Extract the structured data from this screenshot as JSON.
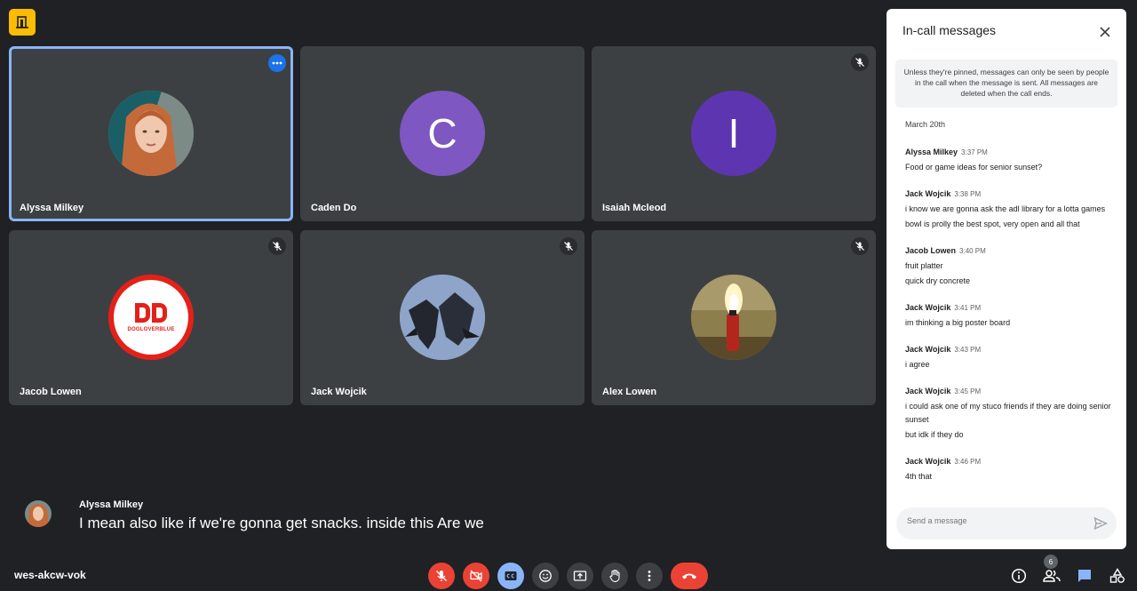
{
  "meeting": {
    "code": "wes-akcw-vok"
  },
  "participants": [
    {
      "name": "Alyssa Milkey",
      "avatar_type": "photo-woman",
      "muted": false,
      "active": true
    },
    {
      "name": "Caden Do",
      "avatar_type": "letter",
      "letter": "C",
      "color": "#7e57c2",
      "muted": false
    },
    {
      "name": "Isaiah Mcleod",
      "avatar_type": "letter",
      "letter": "I",
      "color": "#5e35b1",
      "muted": true
    },
    {
      "name": "Jacob Lowen",
      "avatar_type": "logo",
      "logo_text": "DOGLOVERBLUE",
      "muted": true
    },
    {
      "name": "Jack Wojcik",
      "avatar_type": "jets",
      "muted": true
    },
    {
      "name": "Alex Lowen",
      "avatar_type": "fire",
      "muted": true
    }
  ],
  "caption": {
    "speaker": "Alyssa Milkey",
    "text": "I mean also like if we're gonna get snacks. inside this Are we"
  },
  "people_count": "6",
  "chat": {
    "title": "In-call messages",
    "notice": "Unless they're pinned, messages can only be seen by people in the call when the message is sent. All messages are deleted when the call ends.",
    "date": "March 20th",
    "messages": [
      {
        "sender": "Alyssa Milkey",
        "time": "3:37 PM",
        "lines": [
          "Food or game ideas for senior sunset?"
        ]
      },
      {
        "sender": "Jack Wojcik",
        "time": "3:38 PM",
        "lines": [
          "i know we are gonna ask the adl library for a lotta games",
          "bowl is prolly the best spot, very open and all that"
        ]
      },
      {
        "sender": "Jacob Lowen",
        "time": "3:40 PM",
        "lines": [
          "fruit platter",
          "quick dry concrete"
        ]
      },
      {
        "sender": "Jack Wojcik",
        "time": "3:41 PM",
        "lines": [
          "im thinking a big poster board"
        ]
      },
      {
        "sender": "Jack Wojcik",
        "time": "3:43 PM",
        "lines": [
          "i agree"
        ]
      },
      {
        "sender": "Jack Wojcik",
        "time": "3:45 PM",
        "lines": [
          "i could ask one of my stuco friends if they are doing senior sunset",
          "but idk if they do"
        ]
      },
      {
        "sender": "Jack Wojcik",
        "time": "3:46 PM",
        "lines": [
          "4th that"
        ]
      }
    ],
    "input_placeholder": "Send a message"
  },
  "colors": {
    "accent": "#8ab4f8",
    "danger": "#ea4335",
    "tile_bg": "#3c4043",
    "page_bg": "#202124"
  }
}
